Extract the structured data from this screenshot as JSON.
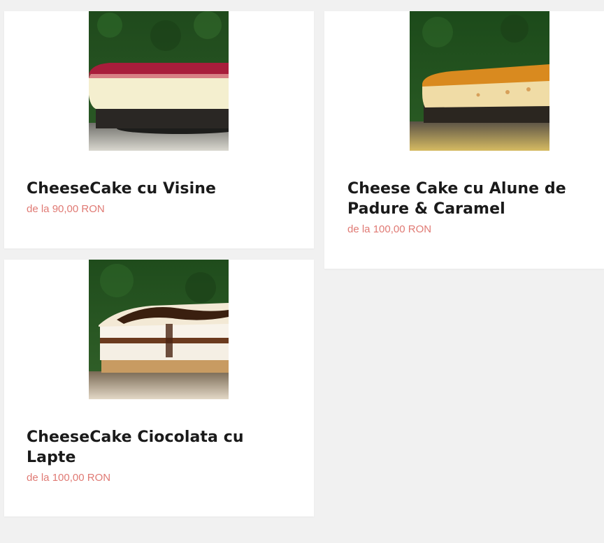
{
  "products": [
    {
      "name": "CheeseCake cu Visine",
      "price": "de la 90,00 RON",
      "image_icon": "cheesecake-visine-image"
    },
    {
      "name": "Cheese Cake cu Alune de Padure & Caramel",
      "price": "de la 100,00 RON",
      "image_icon": "cheesecake-alune-caramel-image"
    },
    {
      "name": "CheeseCake Ciocolata cu Lapte",
      "price": "de la 100,00 RON",
      "image_icon": "cheesecake-ciocolata-image"
    }
  ],
  "colors": {
    "background": "#f1f1f1",
    "card": "#ffffff",
    "title": "#1a1a1a",
    "price": "#e07a74"
  }
}
